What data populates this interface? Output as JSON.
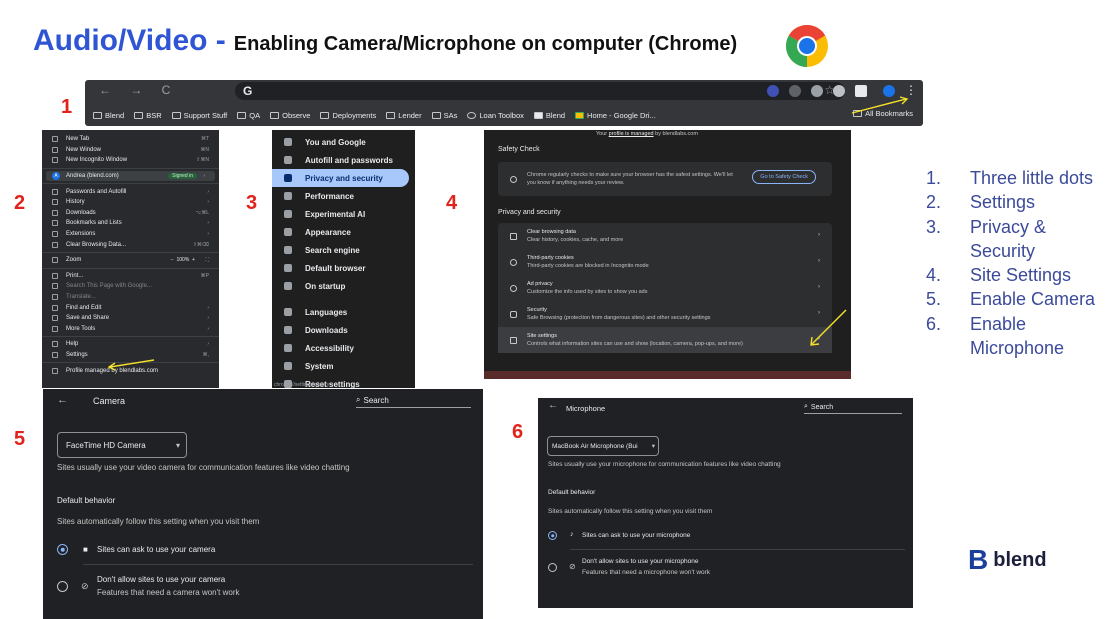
{
  "title": {
    "main": "Audio/Video -",
    "sub": "Enabling Camera/Microphone on computer (Chrome)"
  },
  "step_numbers": [
    "1",
    "2",
    "3",
    "4",
    "5",
    "6"
  ],
  "toolbar": {
    "omnibox_text": "G",
    "nav_glyphs": "← → C",
    "bookmarks": [
      "Blend",
      "BSR",
      "Support Stuff",
      "QA",
      "Observe",
      "Deployments",
      "Lender",
      "SAs",
      "Loan Toolbox",
      "Blend",
      "Home - Google Dri..."
    ],
    "all_bookmarks": "All Bookmarks",
    "extension_colors": [
      "#3f51b5",
      "#5f6368",
      "#9aa0a6",
      "#bdc1c6",
      "#e8eaed",
      "#1a73e8"
    ]
  },
  "menu": {
    "items_top": [
      {
        "label": "New Tab",
        "shortcut": "⌘T"
      },
      {
        "label": "New Window",
        "shortcut": "⌘N"
      },
      {
        "label": "New Incognito Window",
        "shortcut": "⇧⌘N"
      }
    ],
    "profile": {
      "initial": "A",
      "name": "Andrea (blend.com)",
      "badge": "Signed in"
    },
    "items_mid": [
      {
        "label": "Passwords and Autofill",
        "shortcut": "›"
      },
      {
        "label": "History",
        "shortcut": "›"
      },
      {
        "label": "Downloads",
        "shortcut": "⌥⌘L"
      },
      {
        "label": "Bookmarks and Lists",
        "shortcut": "›"
      },
      {
        "label": "Extensions",
        "shortcut": "›"
      },
      {
        "label": "Clear Browsing Data...",
        "shortcut": "⇧⌘⌫"
      }
    ],
    "zoom": {
      "label": "Zoom",
      "value": "100%"
    },
    "items_low": [
      {
        "label": "Print...",
        "shortcut": "⌘P"
      },
      {
        "label": "Search This Page with Google...",
        "shortcut": ""
      },
      {
        "label": "Translate...",
        "shortcut": ""
      },
      {
        "label": "Find and Edit",
        "shortcut": "›"
      },
      {
        "label": "Save and Share",
        "shortcut": "›"
      },
      {
        "label": "More Tools",
        "shortcut": "›"
      }
    ],
    "items_bottom": [
      {
        "label": "Help",
        "shortcut": "›"
      },
      {
        "label": "Settings",
        "shortcut": "⌘,"
      }
    ],
    "managed": "Profile managed by blendlabs.com"
  },
  "settings_sidebar": {
    "items_a": [
      "You and Google",
      "Autofill and passwords",
      "Privacy and security",
      "Performance",
      "Experimental AI",
      "Appearance",
      "Search engine",
      "Default browser",
      "On startup"
    ],
    "items_b": [
      "Languages",
      "Downloads",
      "Accessibility",
      "System",
      "Reset settings"
    ],
    "active": "Privacy and security",
    "url": "chrome://settings/privacy"
  },
  "privacy": {
    "managed_prefix": "Your",
    "managed_link": "profile is managed",
    "managed_suffix": "by blendlabs.com",
    "safety_check_heading": "Safety Check",
    "safety_check_text": "Chrome regularly checks to make sure your browser has the safest settings. We'll let you know if anything needs your review.",
    "safety_check_button": "Go to Safety Check",
    "section_heading": "Privacy and security",
    "rows": [
      {
        "title": "Clear browsing data",
        "sub": "Clear history, cookies, cache, and more"
      },
      {
        "title": "Third-party cookies",
        "sub": "Third-party cookies are blocked in Incognito mode"
      },
      {
        "title": "Ad privacy",
        "sub": "Customize the info used by sites to show you ads"
      },
      {
        "title": "Security",
        "sub": "Safe Browsing (protection from dangerous sites) and other security settings"
      },
      {
        "title": "Site settings",
        "sub": "Controls what information sites can use and show (location, camera, pop-ups, and more)"
      }
    ]
  },
  "camera": {
    "title": "Camera",
    "search": "Search",
    "device": "FaceTime HD Camera",
    "description": "Sites usually use your video camera for communication features like video chatting",
    "default_heading": "Default behavior",
    "default_text": "Sites automatically follow this setting when you visit them",
    "option_allow": "Sites can ask to use your camera",
    "option_block": "Don't allow sites to use your camera",
    "option_block_sub": "Features that need a camera won't work"
  },
  "microphone": {
    "title": "Microphone",
    "search": "Search",
    "device": "MacBook Air Microphone (Bui",
    "description": "Sites usually use your microphone for communication features like video chatting",
    "default_heading": "Default behavior",
    "default_text": "Sites automatically follow this setting when you visit them",
    "option_allow": "Sites can ask to use your microphone",
    "option_block": "Don't allow sites to use your microphone",
    "option_block_sub": "Features that need a microphone won't work"
  },
  "steps_list": [
    {
      "num": "1.",
      "label": "Three little dots"
    },
    {
      "num": "2.",
      "label": "Settings"
    },
    {
      "num": "3.",
      "label": "Privacy & Security"
    },
    {
      "num": "4.",
      "label": "Site Settings"
    },
    {
      "num": "5.",
      "label": "Enable Camera"
    },
    {
      "num": "6.",
      "label": "Enable Microphone"
    }
  ],
  "brand": {
    "mark": "B",
    "word": "blend"
  },
  "colors": {
    "title_blue": "#2f55d4",
    "step_red": "#e0231c",
    "list_blue": "#3b4a9a",
    "arrow_yellow": "#f5e12a"
  }
}
